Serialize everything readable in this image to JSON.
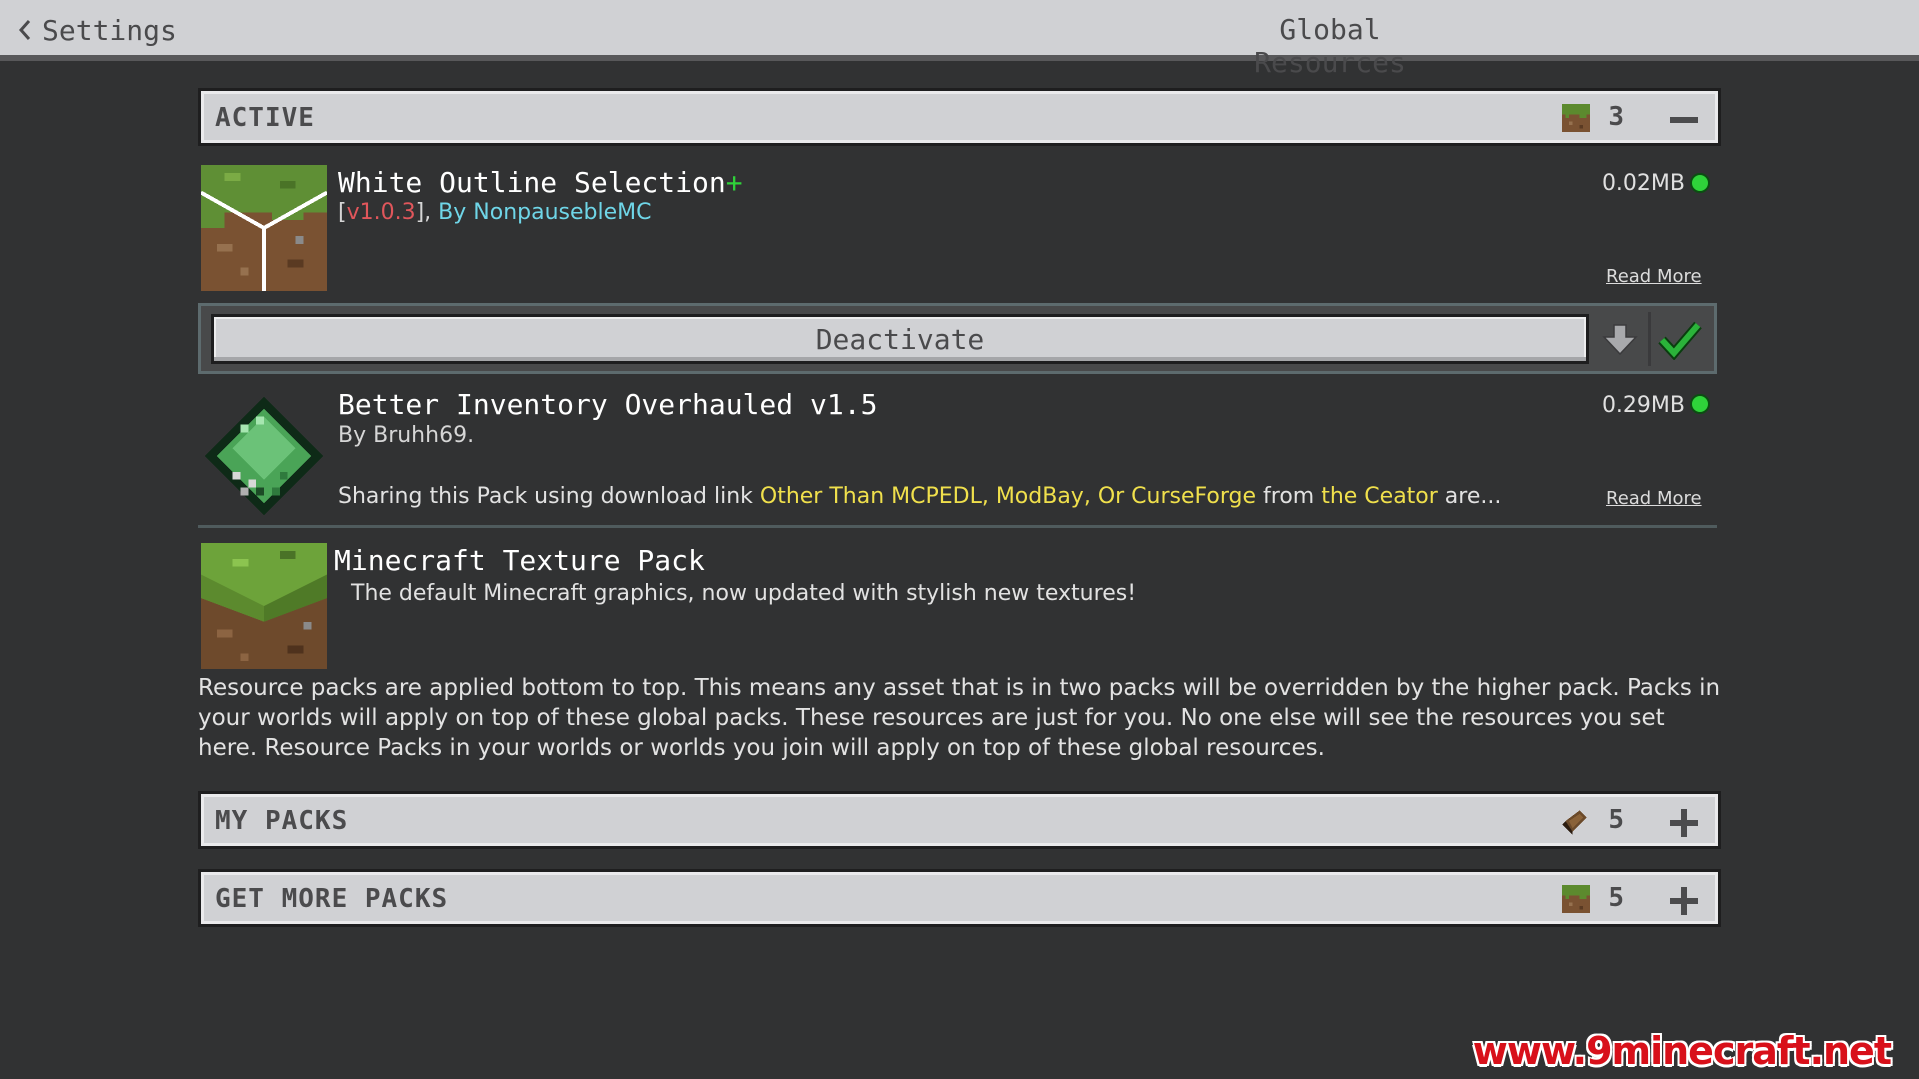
{
  "header": {
    "back_label": "Settings",
    "title": "Global Resources"
  },
  "sections": {
    "active": {
      "label": "ACTIVE",
      "count": "3",
      "toggle_icon": "minus-icon"
    },
    "my_packs": {
      "label": "MY PACKS",
      "count": "5",
      "toggle_icon": "plus-icon"
    },
    "get_more": {
      "label": "GET MORE PACKS",
      "count": "5",
      "toggle_icon": "plus-icon"
    }
  },
  "packs": [
    {
      "name": "White Outline Selection",
      "name_suffix": "+",
      "version": "v1.0.3",
      "author": "By NonpausebleMC",
      "size": "0.02MB",
      "read_more": "Read More",
      "icon": "grass-block-outline-icon"
    },
    {
      "name": "Better Inventory Overhauled v1.5",
      "author": "By Bruhh69.",
      "desc_a": "Sharing this Pack using download link ",
      "desc_hl1": "Other Than MCPEDL, ModBay, Or CurseForge",
      "desc_b": " from ",
      "desc_hl2": "the Ceator",
      "desc_c": " are...",
      "size": "0.29MB",
      "read_more": "Read More",
      "icon": "green-gem-icon"
    },
    {
      "name": "Minecraft Texture Pack",
      "description": "The default Minecraft graphics, now updated with stylish new textures!",
      "icon": "grass-block-icon"
    }
  ],
  "actions": {
    "deactivate_label": "Deactivate",
    "move_down_icon": "arrow-down-icon",
    "check_icon": "checkmark-icon"
  },
  "info_text": "Resource packs are applied bottom to top. This means any asset that is in two packs will be overridden by the higher pack. Packs in your worlds will apply on top of these global packs. These resources are just for you. No one else will see the resources you set here. Resource Packs in your worlds or worlds you join will apply on top of these global resources.",
  "watermark": "www.9minecraft.net",
  "colors": {
    "status_green": "#2fd33a",
    "highlight_yellow": "#f0e04c",
    "version_red": "#e0565b",
    "author_cyan": "#6fd6e8"
  }
}
